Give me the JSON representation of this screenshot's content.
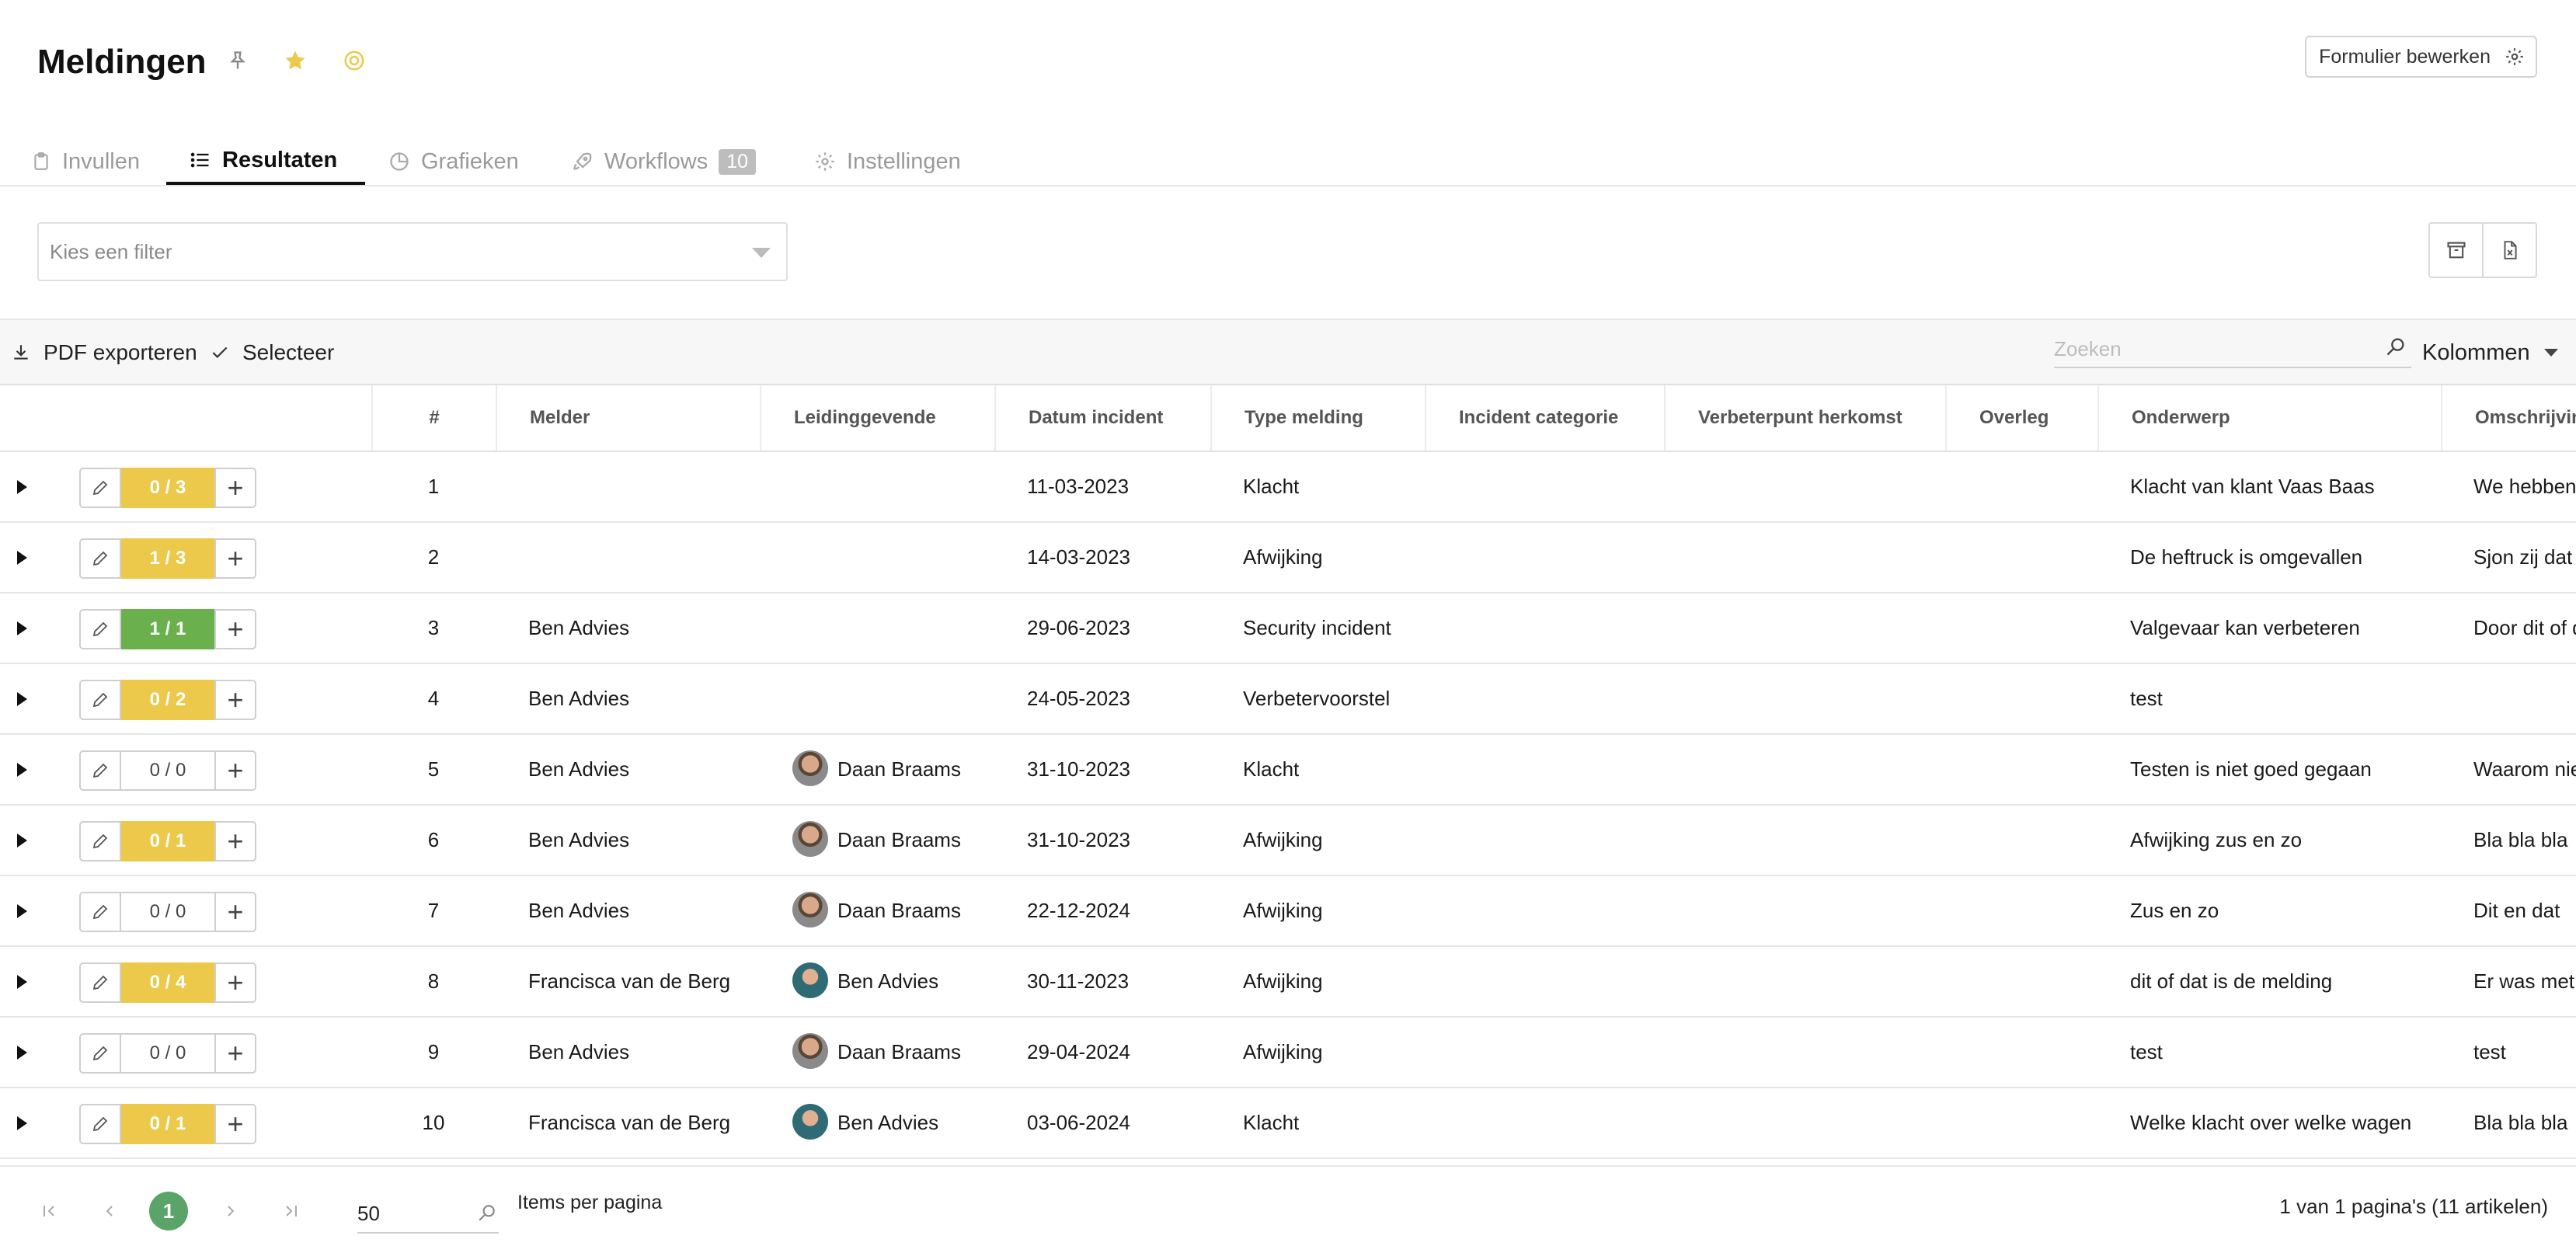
{
  "header": {
    "title": "Meldingen",
    "edit_form_label": "Formulier bewerken",
    "icons": [
      "pin-icon",
      "star-icon",
      "target-icon",
      "gear-icon"
    ],
    "accent_star": "#ecc94b"
  },
  "tabs": [
    {
      "label": "Invullen",
      "icon": "clipboard-icon",
      "active": false
    },
    {
      "label": "Resultaten",
      "icon": "list-icon",
      "active": true
    },
    {
      "label": "Grafieken",
      "icon": "pie-chart-icon",
      "active": false
    },
    {
      "label": "Workflows",
      "icon": "rocket-icon",
      "badge": "10",
      "active": false
    },
    {
      "label": "Instellingen",
      "icon": "gear-icon",
      "active": false
    }
  ],
  "filter": {
    "placeholder": "Kies een filter"
  },
  "toolbar": {
    "pdf_export": "PDF exporteren",
    "select": "Selecteer",
    "search_placeholder": "Zoeken",
    "columns": "Kolommen"
  },
  "table": {
    "columns": [
      "#",
      "Melder",
      "Leidinggevende",
      "Datum incident",
      "Type melding",
      "Incident categorie",
      "Verbeterpunt herkomst",
      "Overleg",
      "Onderwerp",
      "Omschrijving"
    ],
    "rows": [
      {
        "score": "0 / 3",
        "status": "yellow",
        "num": "1",
        "melder": "",
        "leiding": "",
        "avatar": "",
        "datum": "11-03-2023",
        "type": "Klacht",
        "onderwerp": "Klacht van klant Vaas Baas",
        "omschrijving": "We hebben"
      },
      {
        "score": "1 / 3",
        "status": "yellow",
        "num": "2",
        "melder": "",
        "leiding": "",
        "avatar": "",
        "datum": "14-03-2023",
        "type": "Afwijking",
        "onderwerp": "De heftruck is omgevallen",
        "omschrijving": "Sjon zij dat"
      },
      {
        "score": "1 / 1",
        "status": "green",
        "num": "3",
        "melder": "Ben Advies",
        "leiding": "",
        "avatar": "",
        "datum": "29-06-2023",
        "type": "Security incident",
        "onderwerp": "Valgevaar kan verbeteren",
        "omschrijving": "Door dit of d"
      },
      {
        "score": "0 / 2",
        "status": "yellow",
        "num": "4",
        "melder": "Ben Advies",
        "leiding": "",
        "avatar": "",
        "datum": "24-05-2023",
        "type": "Verbetervoorstel",
        "onderwerp": "test",
        "omschrijving": ""
      },
      {
        "score": "0 / 0",
        "status": "empty",
        "num": "5",
        "melder": "Ben Advies",
        "leiding": "Daan Braams",
        "avatar": "daan",
        "datum": "31-10-2023",
        "type": "Klacht",
        "onderwerp": "Testen is niet goed gegaan",
        "omschrijving": "Waarom nie"
      },
      {
        "score": "0 / 1",
        "status": "yellow",
        "num": "6",
        "melder": "Ben Advies",
        "leiding": "Daan Braams",
        "avatar": "daan",
        "datum": "31-10-2023",
        "type": "Afwijking",
        "onderwerp": "Afwijking zus en zo",
        "omschrijving": "Bla bla bla"
      },
      {
        "score": "0 / 0",
        "status": "empty",
        "num": "7",
        "melder": "Ben Advies",
        "leiding": "Daan Braams",
        "avatar": "daan",
        "datum": "22-12-2024",
        "type": "Afwijking",
        "onderwerp": "Zus en zo",
        "omschrijving": "Dit en dat"
      },
      {
        "score": "0 / 4",
        "status": "yellow",
        "num": "8",
        "melder": "Francisca van de Berg",
        "leiding": "Ben Advies",
        "avatar": "ben",
        "datum": "30-11-2023",
        "type": "Afwijking",
        "onderwerp": "dit of dat is de melding",
        "omschrijving": "Er was met"
      },
      {
        "score": "0 / 0",
        "status": "empty",
        "num": "9",
        "melder": "Ben Advies",
        "leiding": "Daan Braams",
        "avatar": "daan",
        "datum": "29-04-2024",
        "type": "Afwijking",
        "onderwerp": "test",
        "omschrijving": "test"
      },
      {
        "score": "0 / 1",
        "status": "yellow",
        "num": "10",
        "melder": "Francisca van de Berg",
        "leiding": "Ben Advies",
        "avatar": "ben",
        "datum": "03-06-2024",
        "type": "Klacht",
        "onderwerp": "Welke klacht over welke wagen",
        "omschrijving": "Bla bla bla"
      }
    ]
  },
  "pagination": {
    "current_page": "1",
    "items_per_page": "50",
    "items_per_page_label": "Items per pagina",
    "info": "1 van 1 pagina's (11 artikelen)"
  }
}
